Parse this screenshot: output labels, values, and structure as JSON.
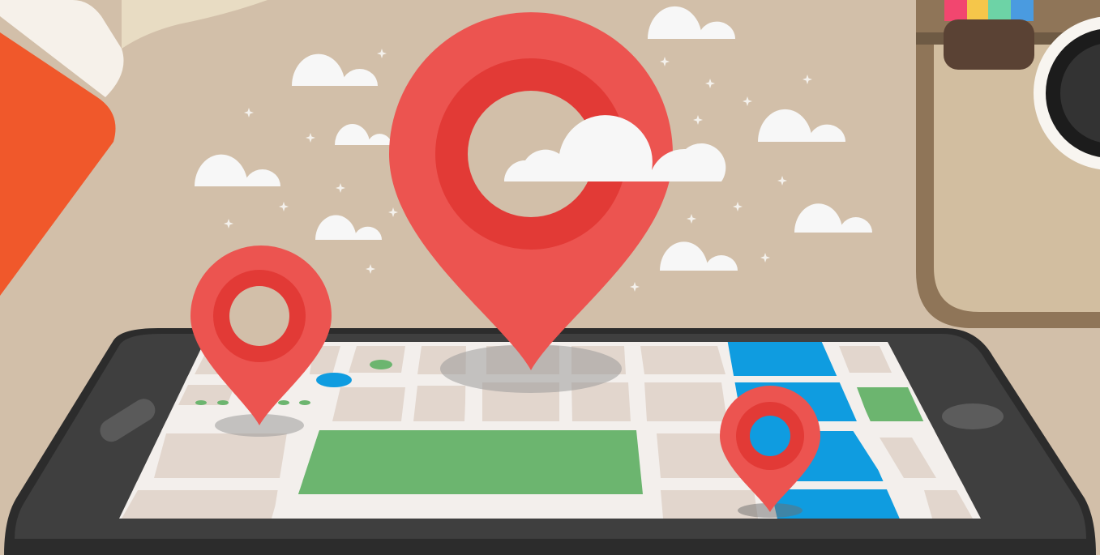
{
  "scene": {
    "description_visible_text": "",
    "colors": {
      "background": "#d2bfa9",
      "pin_outer": "#ec5450",
      "pin_inner": "#e23a36",
      "phone_body": "#3f3f3f",
      "phone_edge": "#2c2c2c",
      "map_block": "#e2d6cd",
      "map_road": "#f3efec",
      "park": "#6cb56f",
      "water": "#0f9ce0",
      "cloud": "#f7f7f7",
      "notebook_orange": "#f0582b",
      "camera_frame": "#8f7558",
      "camera_face": "#d2bea0",
      "camera_lens": "#2b2b2b"
    },
    "icons": [
      "large-location-pin-icon",
      "small-location-pin-icon",
      "map-location-pin-icon",
      "cloud-icon",
      "sparkle-icon",
      "smartphone-icon",
      "camera-icon",
      "notebook-icon"
    ]
  }
}
